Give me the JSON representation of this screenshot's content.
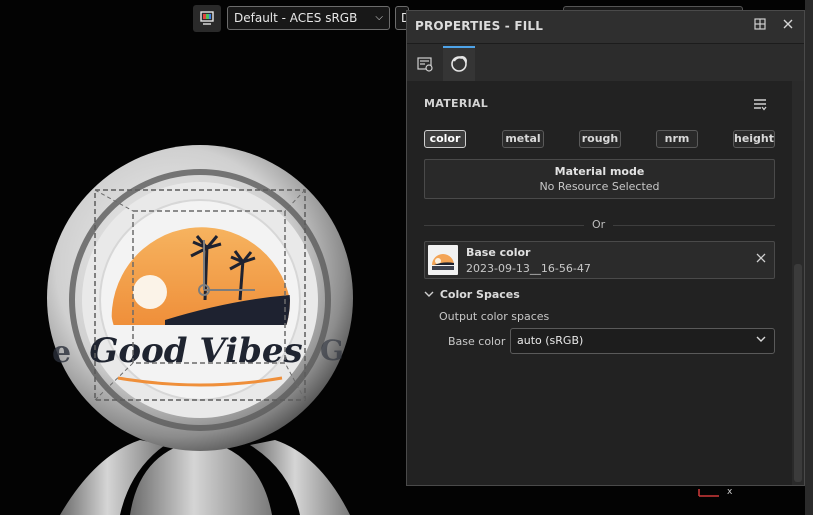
{
  "viewport": {
    "colorspace_select": "Default - ACES sRGB",
    "second_select": "D",
    "logo_text": "Good Vibes",
    "axis_label": "x"
  },
  "panel": {
    "title": "PROPERTIES - FILL",
    "tabs": [
      {
        "icon": "layer-settings-icon",
        "active": false
      },
      {
        "icon": "material-sphere-icon",
        "active": true
      }
    ],
    "section_title": "MATERIAL",
    "channels": [
      {
        "label": "color",
        "active": true
      },
      {
        "label": "metal",
        "active": false
      },
      {
        "label": "rough",
        "active": false
      },
      {
        "label": "nrm",
        "active": false
      },
      {
        "label": "height",
        "active": false
      }
    ],
    "material_mode": {
      "title": "Material mode",
      "value": "No Resource Selected"
    },
    "or_label": "Or",
    "resource": {
      "name": "Base color",
      "date": "2023-09-13__16-56-47"
    },
    "color_spaces": {
      "title": "Color Spaces",
      "subtitle": "Output color spaces",
      "label": "Base color",
      "value": "auto (sRGB)"
    }
  },
  "colors": {
    "accent": "#4ea3e8",
    "panel_bg": "#252525",
    "viewport_bg": "#030303"
  }
}
